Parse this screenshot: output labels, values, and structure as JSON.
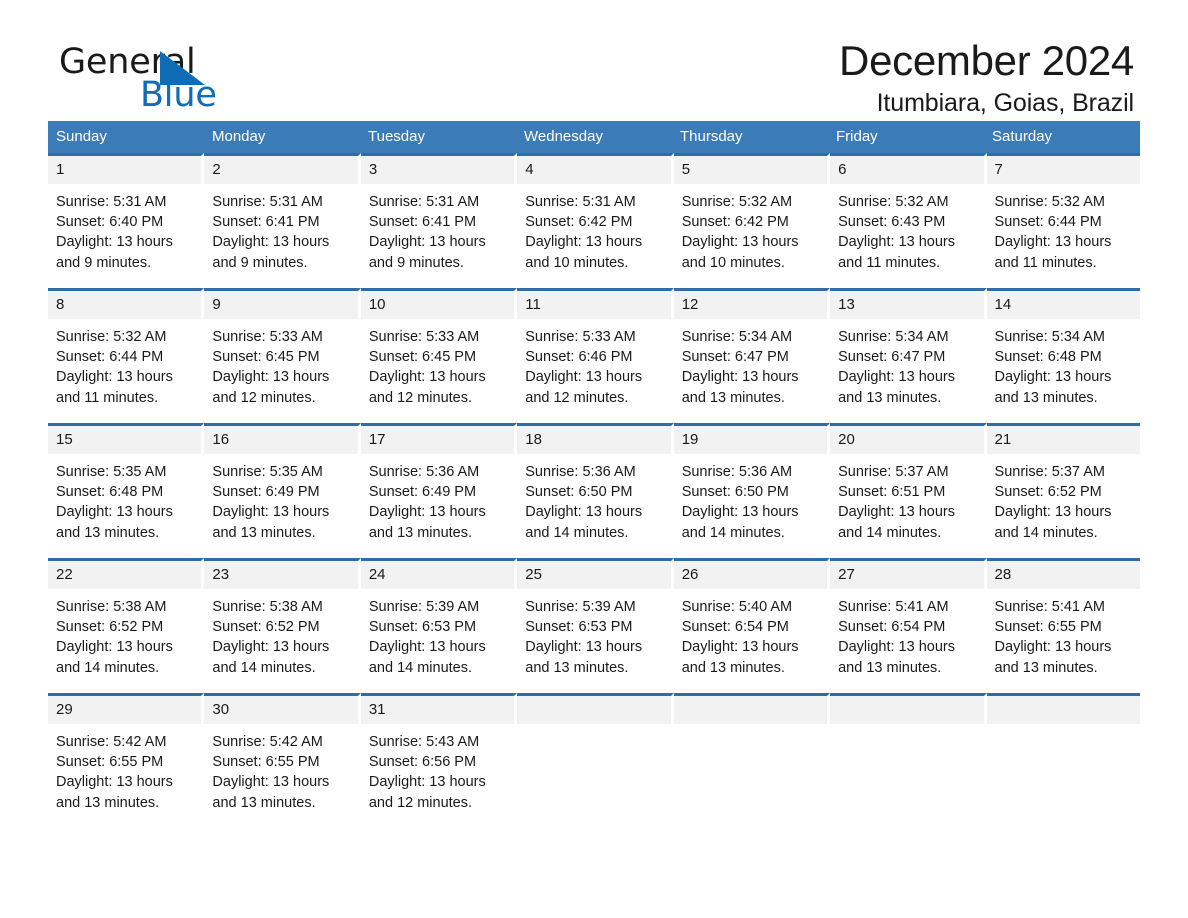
{
  "brand": {
    "name_part1": "General",
    "name_part2": "Blue",
    "triangle_icon": "brand-triangle-icon",
    "accent_color": "#0f6cb5"
  },
  "header": {
    "month_title": "December 2024",
    "location": "Itumbiara, Goias, Brazil"
  },
  "calendar": {
    "header_color": "#3b7cb8",
    "row_divider_color": "#2f6ca8",
    "day_band_color": "#f2f2f2",
    "weekdays": [
      "Sunday",
      "Monday",
      "Tuesday",
      "Wednesday",
      "Thursday",
      "Friday",
      "Saturday"
    ],
    "weeks": [
      [
        {
          "day": "1",
          "sunrise": "Sunrise: 5:31 AM",
          "sunset": "Sunset: 6:40 PM",
          "daylight": "Daylight: 13 hours and 9 minutes."
        },
        {
          "day": "2",
          "sunrise": "Sunrise: 5:31 AM",
          "sunset": "Sunset: 6:41 PM",
          "daylight": "Daylight: 13 hours and 9 minutes."
        },
        {
          "day": "3",
          "sunrise": "Sunrise: 5:31 AM",
          "sunset": "Sunset: 6:41 PM",
          "daylight": "Daylight: 13 hours and 9 minutes."
        },
        {
          "day": "4",
          "sunrise": "Sunrise: 5:31 AM",
          "sunset": "Sunset: 6:42 PM",
          "daylight": "Daylight: 13 hours and 10 minutes."
        },
        {
          "day": "5",
          "sunrise": "Sunrise: 5:32 AM",
          "sunset": "Sunset: 6:42 PM",
          "daylight": "Daylight: 13 hours and 10 minutes."
        },
        {
          "day": "6",
          "sunrise": "Sunrise: 5:32 AM",
          "sunset": "Sunset: 6:43 PM",
          "daylight": "Daylight: 13 hours and 11 minutes."
        },
        {
          "day": "7",
          "sunrise": "Sunrise: 5:32 AM",
          "sunset": "Sunset: 6:44 PM",
          "daylight": "Daylight: 13 hours and 11 minutes."
        }
      ],
      [
        {
          "day": "8",
          "sunrise": "Sunrise: 5:32 AM",
          "sunset": "Sunset: 6:44 PM",
          "daylight": "Daylight: 13 hours and 11 minutes."
        },
        {
          "day": "9",
          "sunrise": "Sunrise: 5:33 AM",
          "sunset": "Sunset: 6:45 PM",
          "daylight": "Daylight: 13 hours and 12 minutes."
        },
        {
          "day": "10",
          "sunrise": "Sunrise: 5:33 AM",
          "sunset": "Sunset: 6:45 PM",
          "daylight": "Daylight: 13 hours and 12 minutes."
        },
        {
          "day": "11",
          "sunrise": "Sunrise: 5:33 AM",
          "sunset": "Sunset: 6:46 PM",
          "daylight": "Daylight: 13 hours and 12 minutes."
        },
        {
          "day": "12",
          "sunrise": "Sunrise: 5:34 AM",
          "sunset": "Sunset: 6:47 PM",
          "daylight": "Daylight: 13 hours and 13 minutes."
        },
        {
          "day": "13",
          "sunrise": "Sunrise: 5:34 AM",
          "sunset": "Sunset: 6:47 PM",
          "daylight": "Daylight: 13 hours and 13 minutes."
        },
        {
          "day": "14",
          "sunrise": "Sunrise: 5:34 AM",
          "sunset": "Sunset: 6:48 PM",
          "daylight": "Daylight: 13 hours and 13 minutes."
        }
      ],
      [
        {
          "day": "15",
          "sunrise": "Sunrise: 5:35 AM",
          "sunset": "Sunset: 6:48 PM",
          "daylight": "Daylight: 13 hours and 13 minutes."
        },
        {
          "day": "16",
          "sunrise": "Sunrise: 5:35 AM",
          "sunset": "Sunset: 6:49 PM",
          "daylight": "Daylight: 13 hours and 13 minutes."
        },
        {
          "day": "17",
          "sunrise": "Sunrise: 5:36 AM",
          "sunset": "Sunset: 6:49 PM",
          "daylight": "Daylight: 13 hours and 13 minutes."
        },
        {
          "day": "18",
          "sunrise": "Sunrise: 5:36 AM",
          "sunset": "Sunset: 6:50 PM",
          "daylight": "Daylight: 13 hours and 14 minutes."
        },
        {
          "day": "19",
          "sunrise": "Sunrise: 5:36 AM",
          "sunset": "Sunset: 6:50 PM",
          "daylight": "Daylight: 13 hours and 14 minutes."
        },
        {
          "day": "20",
          "sunrise": "Sunrise: 5:37 AM",
          "sunset": "Sunset: 6:51 PM",
          "daylight": "Daylight: 13 hours and 14 minutes."
        },
        {
          "day": "21",
          "sunrise": "Sunrise: 5:37 AM",
          "sunset": "Sunset: 6:52 PM",
          "daylight": "Daylight: 13 hours and 14 minutes."
        }
      ],
      [
        {
          "day": "22",
          "sunrise": "Sunrise: 5:38 AM",
          "sunset": "Sunset: 6:52 PM",
          "daylight": "Daylight: 13 hours and 14 minutes."
        },
        {
          "day": "23",
          "sunrise": "Sunrise: 5:38 AM",
          "sunset": "Sunset: 6:52 PM",
          "daylight": "Daylight: 13 hours and 14 minutes."
        },
        {
          "day": "24",
          "sunrise": "Sunrise: 5:39 AM",
          "sunset": "Sunset: 6:53 PM",
          "daylight": "Daylight: 13 hours and 14 minutes."
        },
        {
          "day": "25",
          "sunrise": "Sunrise: 5:39 AM",
          "sunset": "Sunset: 6:53 PM",
          "daylight": "Daylight: 13 hours and 13 minutes."
        },
        {
          "day": "26",
          "sunrise": "Sunrise: 5:40 AM",
          "sunset": "Sunset: 6:54 PM",
          "daylight": "Daylight: 13 hours and 13 minutes."
        },
        {
          "day": "27",
          "sunrise": "Sunrise: 5:41 AM",
          "sunset": "Sunset: 6:54 PM",
          "daylight": "Daylight: 13 hours and 13 minutes."
        },
        {
          "day": "28",
          "sunrise": "Sunrise: 5:41 AM",
          "sunset": "Sunset: 6:55 PM",
          "daylight": "Daylight: 13 hours and 13 minutes."
        }
      ],
      [
        {
          "day": "29",
          "sunrise": "Sunrise: 5:42 AM",
          "sunset": "Sunset: 6:55 PM",
          "daylight": "Daylight: 13 hours and 13 minutes."
        },
        {
          "day": "30",
          "sunrise": "Sunrise: 5:42 AM",
          "sunset": "Sunset: 6:55 PM",
          "daylight": "Daylight: 13 hours and 13 minutes."
        },
        {
          "day": "31",
          "sunrise": "Sunrise: 5:43 AM",
          "sunset": "Sunset: 6:56 PM",
          "daylight": "Daylight: 13 hours and 12 minutes."
        },
        {
          "day": "",
          "sunrise": "",
          "sunset": "",
          "daylight": ""
        },
        {
          "day": "",
          "sunrise": "",
          "sunset": "",
          "daylight": ""
        },
        {
          "day": "",
          "sunrise": "",
          "sunset": "",
          "daylight": ""
        },
        {
          "day": "",
          "sunrise": "",
          "sunset": "",
          "daylight": ""
        }
      ]
    ]
  }
}
